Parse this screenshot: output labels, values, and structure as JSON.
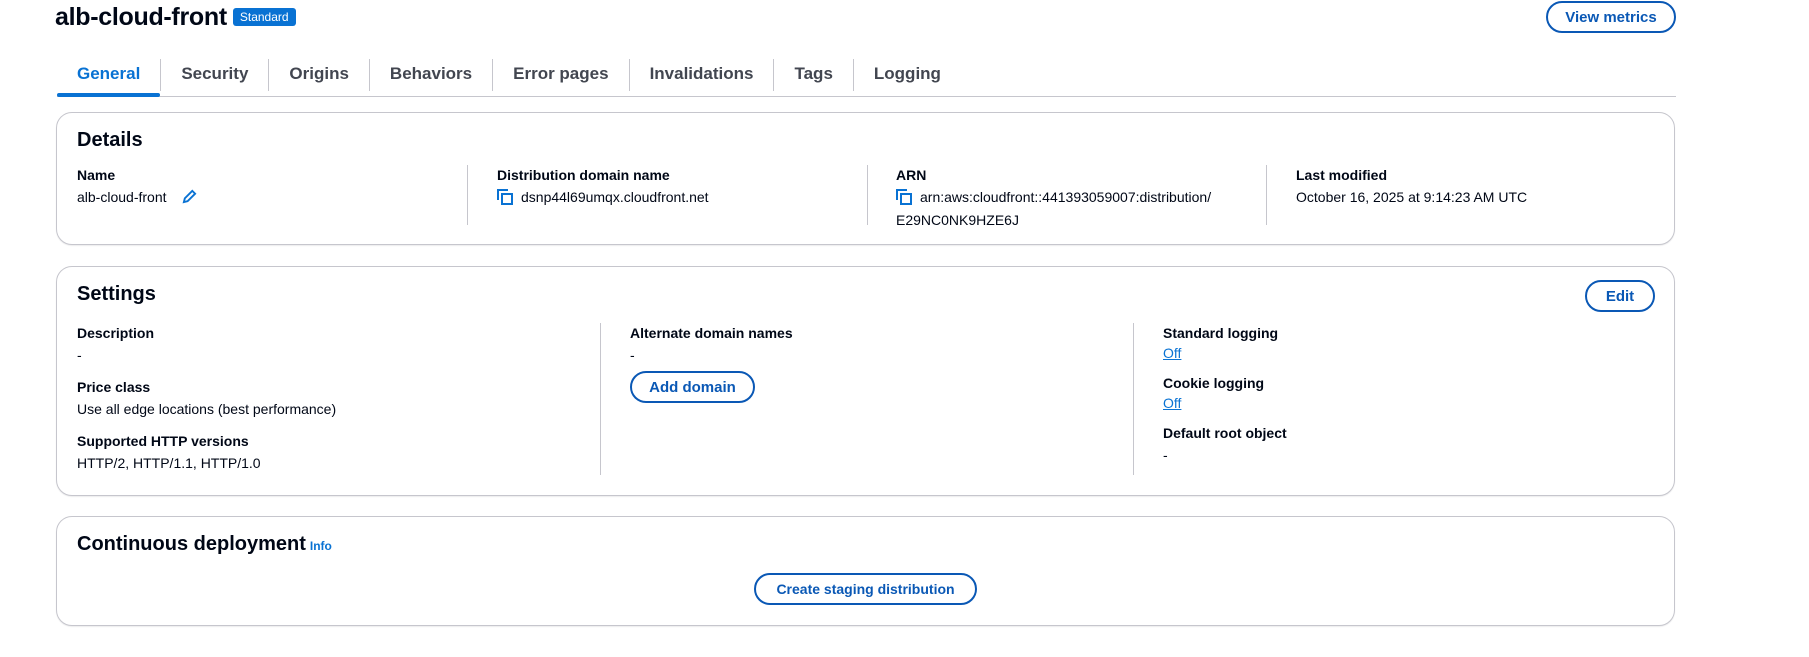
{
  "header": {
    "title": "alb-cloud-front",
    "badge": "Standard",
    "view_metrics_label": "View metrics"
  },
  "tabs": [
    {
      "label": "General",
      "active": true
    },
    {
      "label": "Security"
    },
    {
      "label": "Origins"
    },
    {
      "label": "Behaviors"
    },
    {
      "label": "Error pages"
    },
    {
      "label": "Invalidations"
    },
    {
      "label": "Tags"
    },
    {
      "label": "Logging"
    }
  ],
  "details": {
    "title": "Details",
    "name_label": "Name",
    "name_value": "alb-cloud-front",
    "domain_label": "Distribution domain name",
    "domain_value": "dsnp44l69umqx.cloudfront.net",
    "arn_label": "ARN",
    "arn_line1": "arn:aws:cloudfront::441393059007:distribution/",
    "arn_line2": "E29NC0NK9HZE6J",
    "modified_label": "Last modified",
    "modified_value": "October 16, 2025 at 9:14:23 AM UTC"
  },
  "settings": {
    "title": "Settings",
    "edit_label": "Edit",
    "description_label": "Description",
    "description_value": "-",
    "price_class_label": "Price class",
    "price_class_value": "Use all edge locations (best performance)",
    "http_versions_label": "Supported HTTP versions",
    "http_versions_value": "HTTP/2, HTTP/1.1, HTTP/1.0",
    "alt_domains_label": "Alternate domain names",
    "alt_domains_value": "-",
    "add_domain_label": "Add domain",
    "std_logging_label": "Standard logging",
    "std_logging_value": "Off",
    "cookie_logging_label": "Cookie logging",
    "cookie_logging_value": "Off",
    "root_object_label": "Default root object",
    "root_object_value": "-"
  },
  "continuous": {
    "title": "Continuous deployment",
    "info_label": "Info",
    "create_staging_label": "Create staging distribution"
  },
  "colors": {
    "accent": "#0972d3",
    "button_border": "#0a58b5",
    "divider": "#c6c6cd",
    "text": "#000716"
  }
}
